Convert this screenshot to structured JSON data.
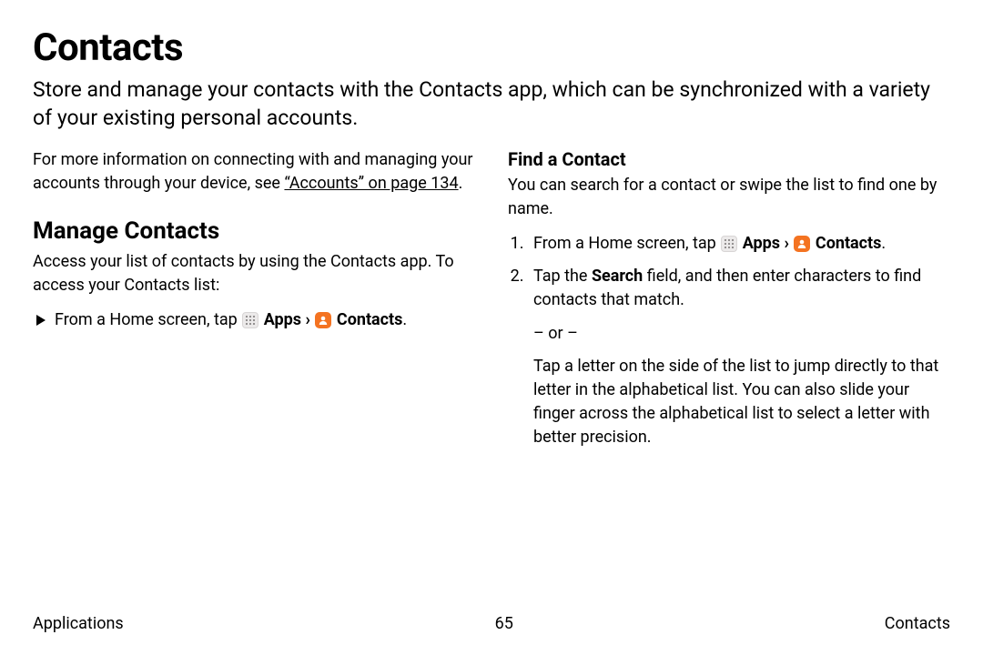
{
  "title": "Contacts",
  "intro": "Store and manage your contacts with the Contacts app, which can be synchronized with a variety of your existing personal accounts.",
  "left": {
    "info_prefix": "For more information on connecting with and managing your accounts through your device, see ",
    "link_text": "“Accounts” on page 134",
    "manage_heading": "Manage Contacts",
    "manage_intro": "Access your list of contacts by using the Contacts app. To access your Contacts list:",
    "bullet_prefix": "From a Home screen, tap ",
    "apps_label": " Apps",
    "arrow": " › ",
    "contacts_label": " Contacts",
    "period": "."
  },
  "right": {
    "find_heading": "Find a Contact",
    "find_intro": "You can search for a contact or swipe the list to find one by name.",
    "step1_prefix": "From a Home screen, tap ",
    "step2_prefix": "Tap the ",
    "step2_bold": "Search",
    "step2_suffix": " field, and then enter characters to find contacts that match.",
    "or": "– or –",
    "alt": "Tap a letter on the side of the list to jump directly to that letter in the alphabetical list. You can also slide your finger across the alphabetical list to select a letter with better precision."
  },
  "footer": {
    "left": "Applications",
    "center": "65",
    "right": "Contacts"
  }
}
